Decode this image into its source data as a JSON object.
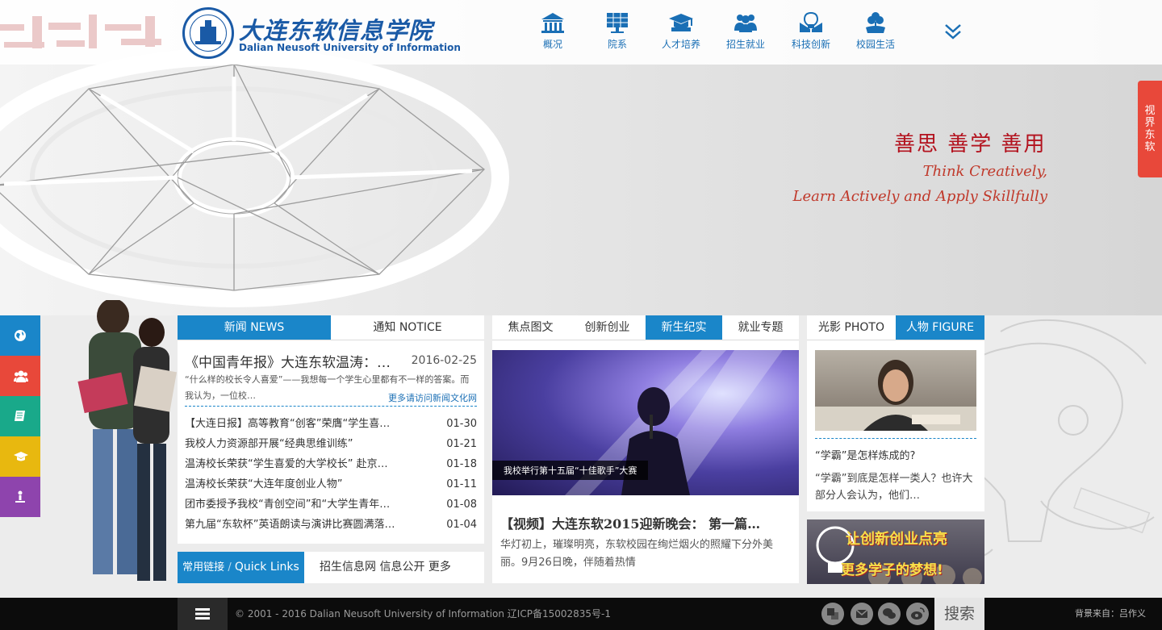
{
  "header": {
    "logo_cn": "大连东软信息学院",
    "logo_en": "Dalian Neusoft University of Information",
    "nav": [
      {
        "label": "概况",
        "icon": "building-icon"
      },
      {
        "label": "院系",
        "icon": "solar-panel-icon"
      },
      {
        "label": "人才培养",
        "icon": "graduation-cap-icon"
      },
      {
        "label": "招生就业",
        "icon": "people-group-icon"
      },
      {
        "label": "科技创新",
        "icon": "lightbulb-book-icon"
      },
      {
        "label": "校园生活",
        "icon": "flower-hand-icon"
      }
    ],
    "more_icon": "chevron-double-down-icon"
  },
  "hero": {
    "slogan_cn": "善思 善学 善用",
    "slogan_en_1": "Think Creatively,",
    "slogan_en_2": "Learn Actively and Apply Skillfully"
  },
  "side_tab": {
    "chars": [
      "视",
      "界",
      "东",
      "软"
    ]
  },
  "side_icons": [
    {
      "icon": "globe-icon",
      "color": "#1a86c9"
    },
    {
      "icon": "users-icon",
      "color": "#e8483a"
    },
    {
      "icon": "book-icon",
      "color": "#19a98a"
    },
    {
      "icon": "graduation-cap-icon",
      "color": "#e8b80f"
    },
    {
      "icon": "person-icon",
      "color": "#8e44ad"
    }
  ],
  "news_panel": {
    "tabs": [
      "新闻 NEWS",
      "通知 NOTICE"
    ],
    "featured": {
      "title": "《中国青年报》大连东软温涛：教育家…",
      "date": "2016-02-25",
      "summary": "“什么样的校长令人喜爱”——我想每一个学生心里都有不一样的答案。而我认为，一位校…",
      "more": "更多请访问新闻文化网"
    },
    "items": [
      {
        "title": "【大连日报】高等教育“创客”荣膺“学生喜…",
        "date": "01-30"
      },
      {
        "title": "我校人力资源部开展“经典思维训练”",
        "date": "01-21"
      },
      {
        "title": "温涛校长荣获“学生喜爱的大学校长” 赴京…",
        "date": "01-18"
      },
      {
        "title": "温涛校长荣获“大连年度创业人物”",
        "date": "01-11"
      },
      {
        "title": "团市委授予我校“青创空间”和“大学生青年…",
        "date": "01-08"
      },
      {
        "title": "第九届“东软杯”英语朗读与演讲比赛圆满落…",
        "date": "01-04"
      }
    ]
  },
  "quick_links": {
    "label_cn": "常用链接",
    "label_en": "Quick Links",
    "links": [
      "招生信息网",
      "信息公开",
      "更多"
    ]
  },
  "focus_panel": {
    "tabs": [
      "焦点图文",
      "创新创业",
      "新生纪实",
      "就业专题"
    ],
    "active_tab": 2,
    "image_caption": "我校举行第十五届“十佳歌手”大赛",
    "title": "【视频】大连东软2015迎新晚会：  第一篇…",
    "summary": "华灯初上，璀璨明亮，东软校园在绚烂烟火的照耀下分外美丽。9月26日晚，伴随着热情"
  },
  "figure_panel": {
    "tabs": [
      "光影 PHOTO",
      "人物 FIGURE"
    ],
    "active_tab": 1,
    "headline": "“学霸”是怎样炼成的?",
    "summary": "“学霸”到底是怎样一类人？也许大部分人会认为，他们…"
  },
  "banner": {
    "line1": "让创新创业点亮",
    "line2": "更多学子的梦想!"
  },
  "footer": {
    "copyright": "© 2001 - 2016 Dalian Neusoft University of Information 辽ICP备15002835号-1",
    "search_label": "搜索",
    "credit": "背景来自：吕作义",
    "social": [
      "translate-icon",
      "mail-icon",
      "wechat-icon",
      "weibo-icon"
    ]
  }
}
